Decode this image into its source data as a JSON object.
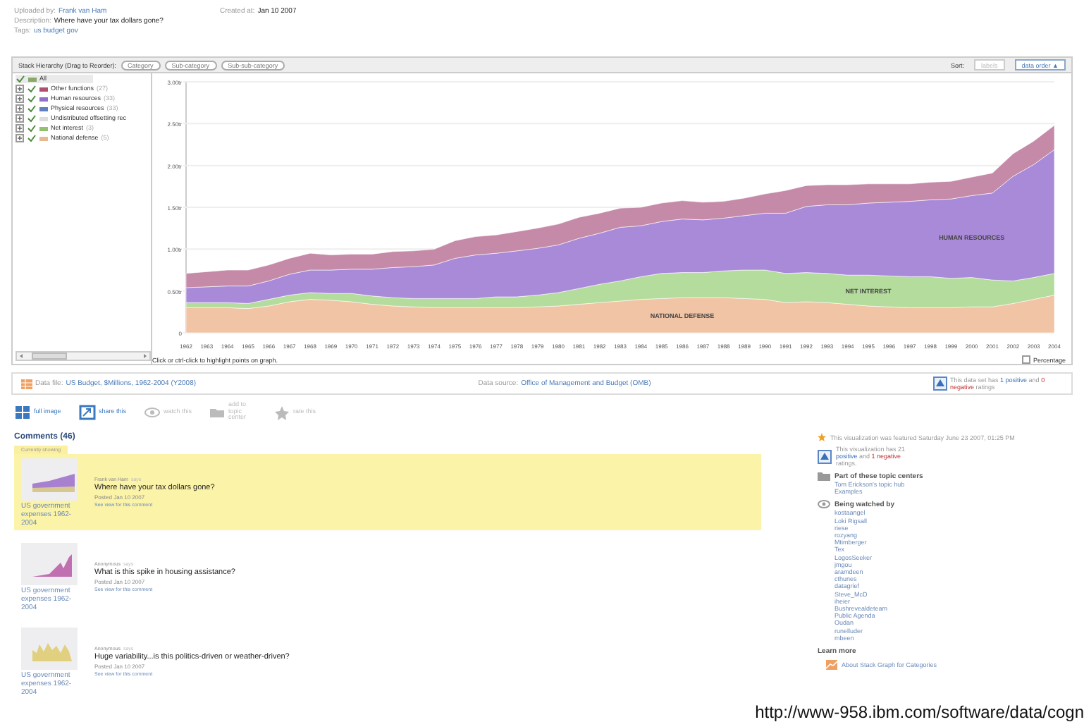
{
  "header": {
    "uploaded_label": "Uploaded by:",
    "uploaded_by": "Frank van Ham",
    "created_label": "Created at:",
    "created": "Jan 10 2007",
    "description_label": "Description:",
    "description": "Where have your tax dollars gone?",
    "tags_label": "Tags:",
    "tags": "us budget gov"
  },
  "toolbar": {
    "hierarchy_label": "Stack Hierarchy (Drag to Reorder):",
    "hierarchy_buttons": [
      "Category",
      "Sub-category",
      "Sub-sub-category"
    ],
    "sort_label": "Sort:",
    "sort_options": [
      {
        "label": "labels",
        "selected": false
      },
      {
        "label": "data order ▲",
        "selected": true
      }
    ]
  },
  "tree": [
    {
      "label": "All",
      "color": "#88aa66",
      "checked": true,
      "expandable": false
    },
    {
      "label": "Other functions",
      "count": "(27)",
      "color": "#b05070",
      "checked": true,
      "expandable": true
    },
    {
      "label": "Human resources",
      "count": "(33)",
      "color": "#9070c8",
      "checked": true,
      "expandable": true
    },
    {
      "label": "Physical resources",
      "count": "(33)",
      "color": "#6080c0",
      "checked": true,
      "expandable": true
    },
    {
      "label": "Undistributed offsetting rec",
      "color": "#dddddd",
      "checked": true,
      "expandable": true
    },
    {
      "label": "Net interest",
      "count": "(3)",
      "color": "#90c070",
      "checked": true,
      "expandable": true
    },
    {
      "label": "National defense",
      "count": "(5)",
      "color": "#e8b890",
      "checked": true,
      "expandable": true
    }
  ],
  "chart": {
    "chart_data": {
      "type": "area",
      "stacked": true,
      "grid": true,
      "categories": [
        "1962",
        "1963",
        "1964",
        "1965",
        "1966",
        "1967",
        "1968",
        "1969",
        "1970",
        "1971",
        "1972",
        "1973",
        "1974",
        "1975",
        "1976",
        "1977",
        "1978",
        "1979",
        "1980",
        "1981",
        "1982",
        "1983",
        "1984",
        "1985",
        "1986",
        "1987",
        "1988",
        "1989",
        "1990",
        "1991",
        "1992",
        "1993",
        "1994",
        "1995",
        "1996",
        "1997",
        "1998",
        "1999",
        "2000",
        "2001",
        "2002",
        "2003",
        "2004"
      ],
      "series": [
        {
          "name": "NATIONAL DEFENSE",
          "color": "#f0c4a4",
          "values": [
            0.3,
            0.3,
            0.3,
            0.29,
            0.32,
            0.37,
            0.4,
            0.39,
            0.37,
            0.34,
            0.32,
            0.31,
            0.3,
            0.3,
            0.3,
            0.3,
            0.3,
            0.31,
            0.32,
            0.34,
            0.36,
            0.38,
            0.4,
            0.41,
            0.42,
            0.42,
            0.42,
            0.41,
            0.4,
            0.36,
            0.37,
            0.36,
            0.34,
            0.32,
            0.31,
            0.3,
            0.3,
            0.3,
            0.31,
            0.31,
            0.35,
            0.4,
            0.45
          ]
        },
        {
          "name": "NET INTEREST",
          "color": "#b4dc9c",
          "values": [
            0.06,
            0.06,
            0.06,
            0.06,
            0.08,
            0.08,
            0.08,
            0.08,
            0.1,
            0.1,
            0.1,
            0.1,
            0.11,
            0.11,
            0.11,
            0.13,
            0.13,
            0.14,
            0.16,
            0.19,
            0.22,
            0.24,
            0.27,
            0.3,
            0.3,
            0.3,
            0.32,
            0.34,
            0.35,
            0.35,
            0.35,
            0.35,
            0.35,
            0.37,
            0.37,
            0.37,
            0.37,
            0.35,
            0.35,
            0.32,
            0.27,
            0.26,
            0.26
          ]
        },
        {
          "name": "HUMAN RESOURCES",
          "color": "#a98ad8",
          "values": [
            0.18,
            0.19,
            0.2,
            0.21,
            0.22,
            0.25,
            0.27,
            0.28,
            0.29,
            0.32,
            0.36,
            0.38,
            0.4,
            0.48,
            0.52,
            0.52,
            0.55,
            0.56,
            0.57,
            0.6,
            0.61,
            0.64,
            0.61,
            0.62,
            0.64,
            0.63,
            0.63,
            0.65,
            0.68,
            0.72,
            0.79,
            0.82,
            0.84,
            0.86,
            0.88,
            0.9,
            0.92,
            0.95,
            0.98,
            1.04,
            1.25,
            1.35,
            1.48
          ]
        },
        {
          "color": "#c48aa8",
          "values": [
            0.17,
            0.18,
            0.19,
            0.19,
            0.19,
            0.19,
            0.2,
            0.18,
            0.18,
            0.18,
            0.19,
            0.19,
            0.19,
            0.21,
            0.22,
            0.22,
            0.23,
            0.24,
            0.25,
            0.25,
            0.24,
            0.23,
            0.22,
            0.22,
            0.22,
            0.21,
            0.2,
            0.21,
            0.23,
            0.27,
            0.25,
            0.24,
            0.24,
            0.23,
            0.22,
            0.21,
            0.21,
            0.21,
            0.22,
            0.24,
            0.27,
            0.28,
            0.29
          ]
        }
      ],
      "ylim": [
        0,
        3
      ],
      "yticks": [
        {
          "value": 0,
          "label": "0"
        },
        {
          "value": 0.5,
          "label": "0.50tr"
        },
        {
          "value": 1,
          "label": "1.00tr"
        },
        {
          "value": 1.5,
          "label": "1.50tr"
        },
        {
          "value": 2,
          "label": "2.00tr"
        },
        {
          "value": 2.5,
          "label": "2.50tr"
        },
        {
          "value": 3,
          "label": "3.00tr"
        }
      ]
    },
    "hint": "Click or ctrl-click to highlight points on graph.",
    "percentage": {
      "label": "Percentage",
      "checked": false
    }
  },
  "data_bar": {
    "file_label": "Data file:",
    "file": "US Budget, $Millions, 1962-2004 (Y2008)",
    "source_label": "Data source:",
    "source": "Office of Management and Budget (OMB)",
    "rating": [
      {
        "text": "This data set has ",
        "kind": "plain"
      },
      {
        "text": "1 positive",
        "kind": "positive"
      },
      {
        "text": " and ",
        "kind": "plain"
      },
      {
        "text": "0 negative",
        "kind": "negative"
      },
      {
        "text": " ratings",
        "kind": "plain"
      }
    ]
  },
  "actions": [
    {
      "label": "full image",
      "kind": "image",
      "disabled": false
    },
    {
      "label": "share this",
      "kind": "share",
      "disabled": false
    },
    {
      "label": "watch this",
      "kind": "watch",
      "disabled": true
    },
    {
      "label": "add to topic center",
      "kind": "topic",
      "disabled": true
    },
    {
      "label": "rate this",
      "kind": "rate",
      "disabled": true
    }
  ],
  "comments": {
    "title": "Comments (46)",
    "current_tab": "Currently showing",
    "items": [
      {
        "selected": true,
        "kind": "area",
        "caption": "US government expenses 1962-2004",
        "author": "Frank van Ham",
        "says": "says",
        "text": "Where have your tax dollars gone?",
        "posted": "Posted Jan 10 2007",
        "link": "See view for this comment"
      },
      {
        "selected": false,
        "kind": "spike",
        "caption": "US government expenses 1962-2004",
        "author": "Anonymous",
        "says": "says",
        "text": "What is this spike in housing assistance?",
        "posted": "Posted Jan 10 2007",
        "link": "See view for this comment"
      },
      {
        "selected": false,
        "kind": "bars",
        "caption": "US government expenses 1962-2004",
        "author": "Anonymous",
        "says": "says",
        "text": "Huge variability...is this politics-driven or weather-driven?",
        "posted": "Posted Jan 10 2007",
        "link": "See view for this comment"
      }
    ]
  },
  "sidebar": {
    "featured": "This visualization was featured Saturday June 23 2007, 01:25 PM",
    "rating": [
      {
        "text": "This visualization has 21 ",
        "kind": "plain"
      },
      {
        "text": "positive",
        "kind": "positive"
      },
      {
        "text": " and ",
        "kind": "plain"
      },
      {
        "text": "1 negative",
        "kind": "negative"
      },
      {
        "text": " ratings.",
        "kind": "plain"
      }
    ],
    "topics_title": "Part of these topic centers",
    "topics": [
      "Tom Erickson's topic hub",
      "Examples"
    ],
    "watch_title": "Being watched by",
    "watchers": [
      "kostaangel",
      "Loki Rigsall",
      "riese",
      "rozyang",
      "Mtimberger",
      "Tex",
      "LogosSeeker",
      "jmgou",
      "aramdeen",
      "cthunes",
      "datagrief",
      "Steve_McD",
      "iheier",
      "Bushrevealdeteam",
      "Public Agenda",
      "Oudan",
      "runelluder",
      "mbeen"
    ],
    "learn_title": "Learn more",
    "learn_link": "About Stack Graph for Categories"
  },
  "url": "http://www-958.ibm.com/software/data/cogn"
}
